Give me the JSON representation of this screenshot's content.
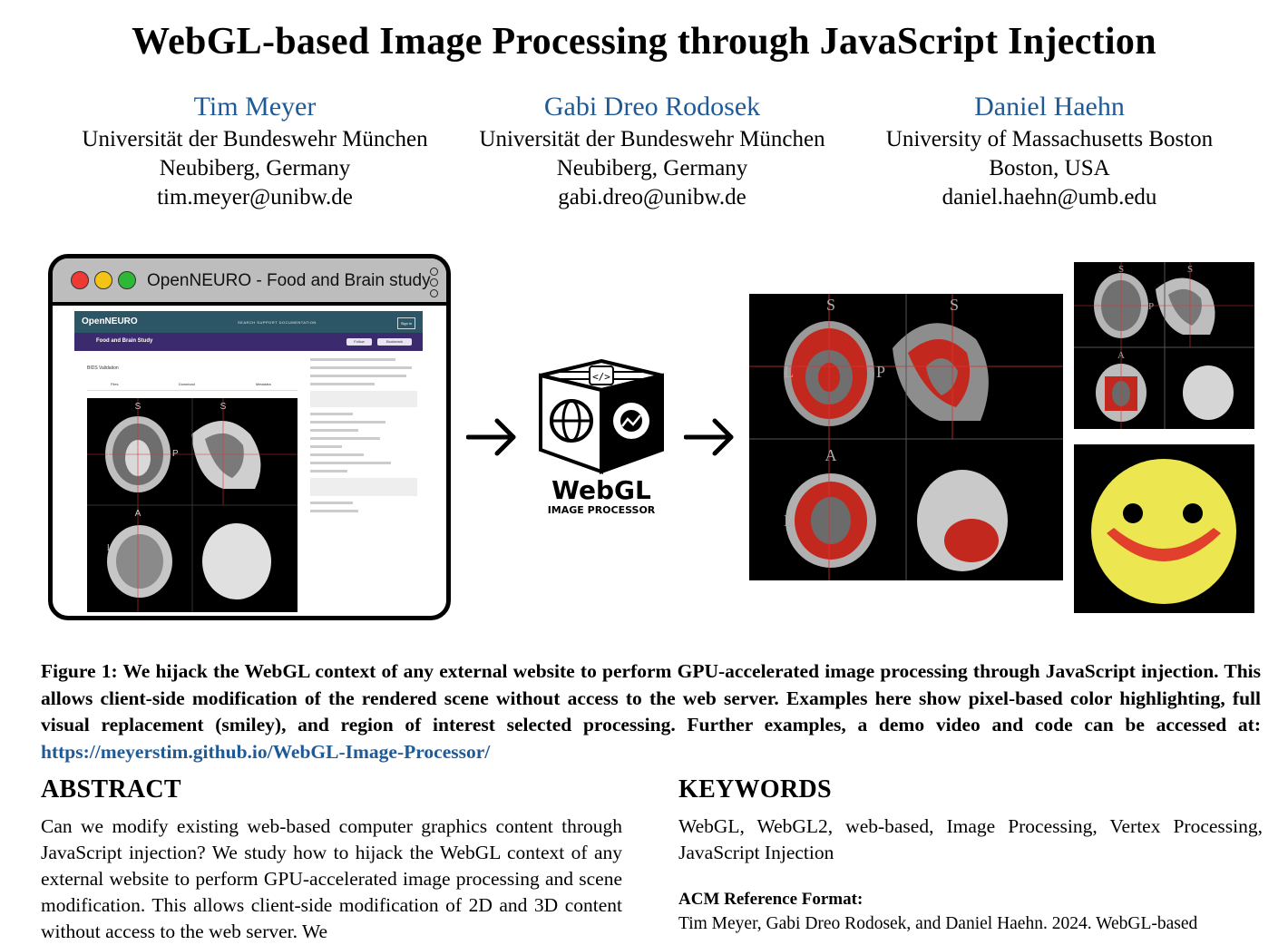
{
  "title": "WebGL-based Image Processing through JavaScript Injection",
  "authors": [
    {
      "name": "Tim Meyer",
      "affiliation": "Universität der Bundeswehr München",
      "location": "Neubiberg, Germany",
      "email": "tim.meyer@unibw.de"
    },
    {
      "name": "Gabi Dreo Rodosek",
      "affiliation": "Universität der Bundeswehr München",
      "location": "Neubiberg, Germany",
      "email": "gabi.dreo@unibw.de"
    },
    {
      "name": "Daniel Haehn",
      "affiliation": "University of Massachusetts Boston",
      "location": "Boston, USA",
      "email": "daniel.haehn@umb.edu"
    }
  ],
  "figure": {
    "browser_title": "OpenNEURO - Food and Brain study",
    "site_logo": "OpenNEURO",
    "site_nav": "SEARCH   SUPPORT   DOCUMENTATION",
    "site_signin": "Sign in",
    "study_name": "Food and Brain Study",
    "follow_label": "Follow",
    "bookmark_label": "Bookmark",
    "bids_label": "BIDS Validation",
    "tab_files": "Files",
    "tab_download": "Download",
    "tab_metadata": "Metadata",
    "orient_s": "S",
    "orient_l": "L",
    "orient_p": "P",
    "orient_a": "A",
    "processor_name": "WebGL",
    "processor_sub": "IMAGE PROCESSOR",
    "colors": {
      "brain_highlight": "#e0251b",
      "smiley_face": "#ece650",
      "smiley_mouth": "#e0402c",
      "link": "#1f5a96"
    }
  },
  "caption": {
    "prefix": "Figure 1: We hijack the WebGL context of any external website to perform GPU-accelerated image processing through JavaScript injection. This allows client-side modification of the rendered scene without access to the web server. Examples here show pixel-based color highlighting, full visual replacement (smiley), and region of interest selected processing. Further examples, a demo video and code can be accessed at: ",
    "link": "https://meyerstim.github.io/WebGL-Image-Processor/"
  },
  "abstract": {
    "heading": "ABSTRACT",
    "text": "Can we modify existing web-based computer graphics content through JavaScript injection? We study how to hijack the WebGL context of any external website to perform GPU-accelerated image processing and scene modification. This allows client-side modification of 2D and 3D content without access to the web server. We"
  },
  "keywords": {
    "heading": "KEYWORDS",
    "text": "WebGL, WebGL2, web-based, Image Processing, Vertex Processing, JavaScript Injection"
  },
  "acm": {
    "heading": "ACM Reference Format:",
    "text": "Tim Meyer, Gabi Dreo Rodosek, and Daniel Haehn. 2024. WebGL-based"
  }
}
